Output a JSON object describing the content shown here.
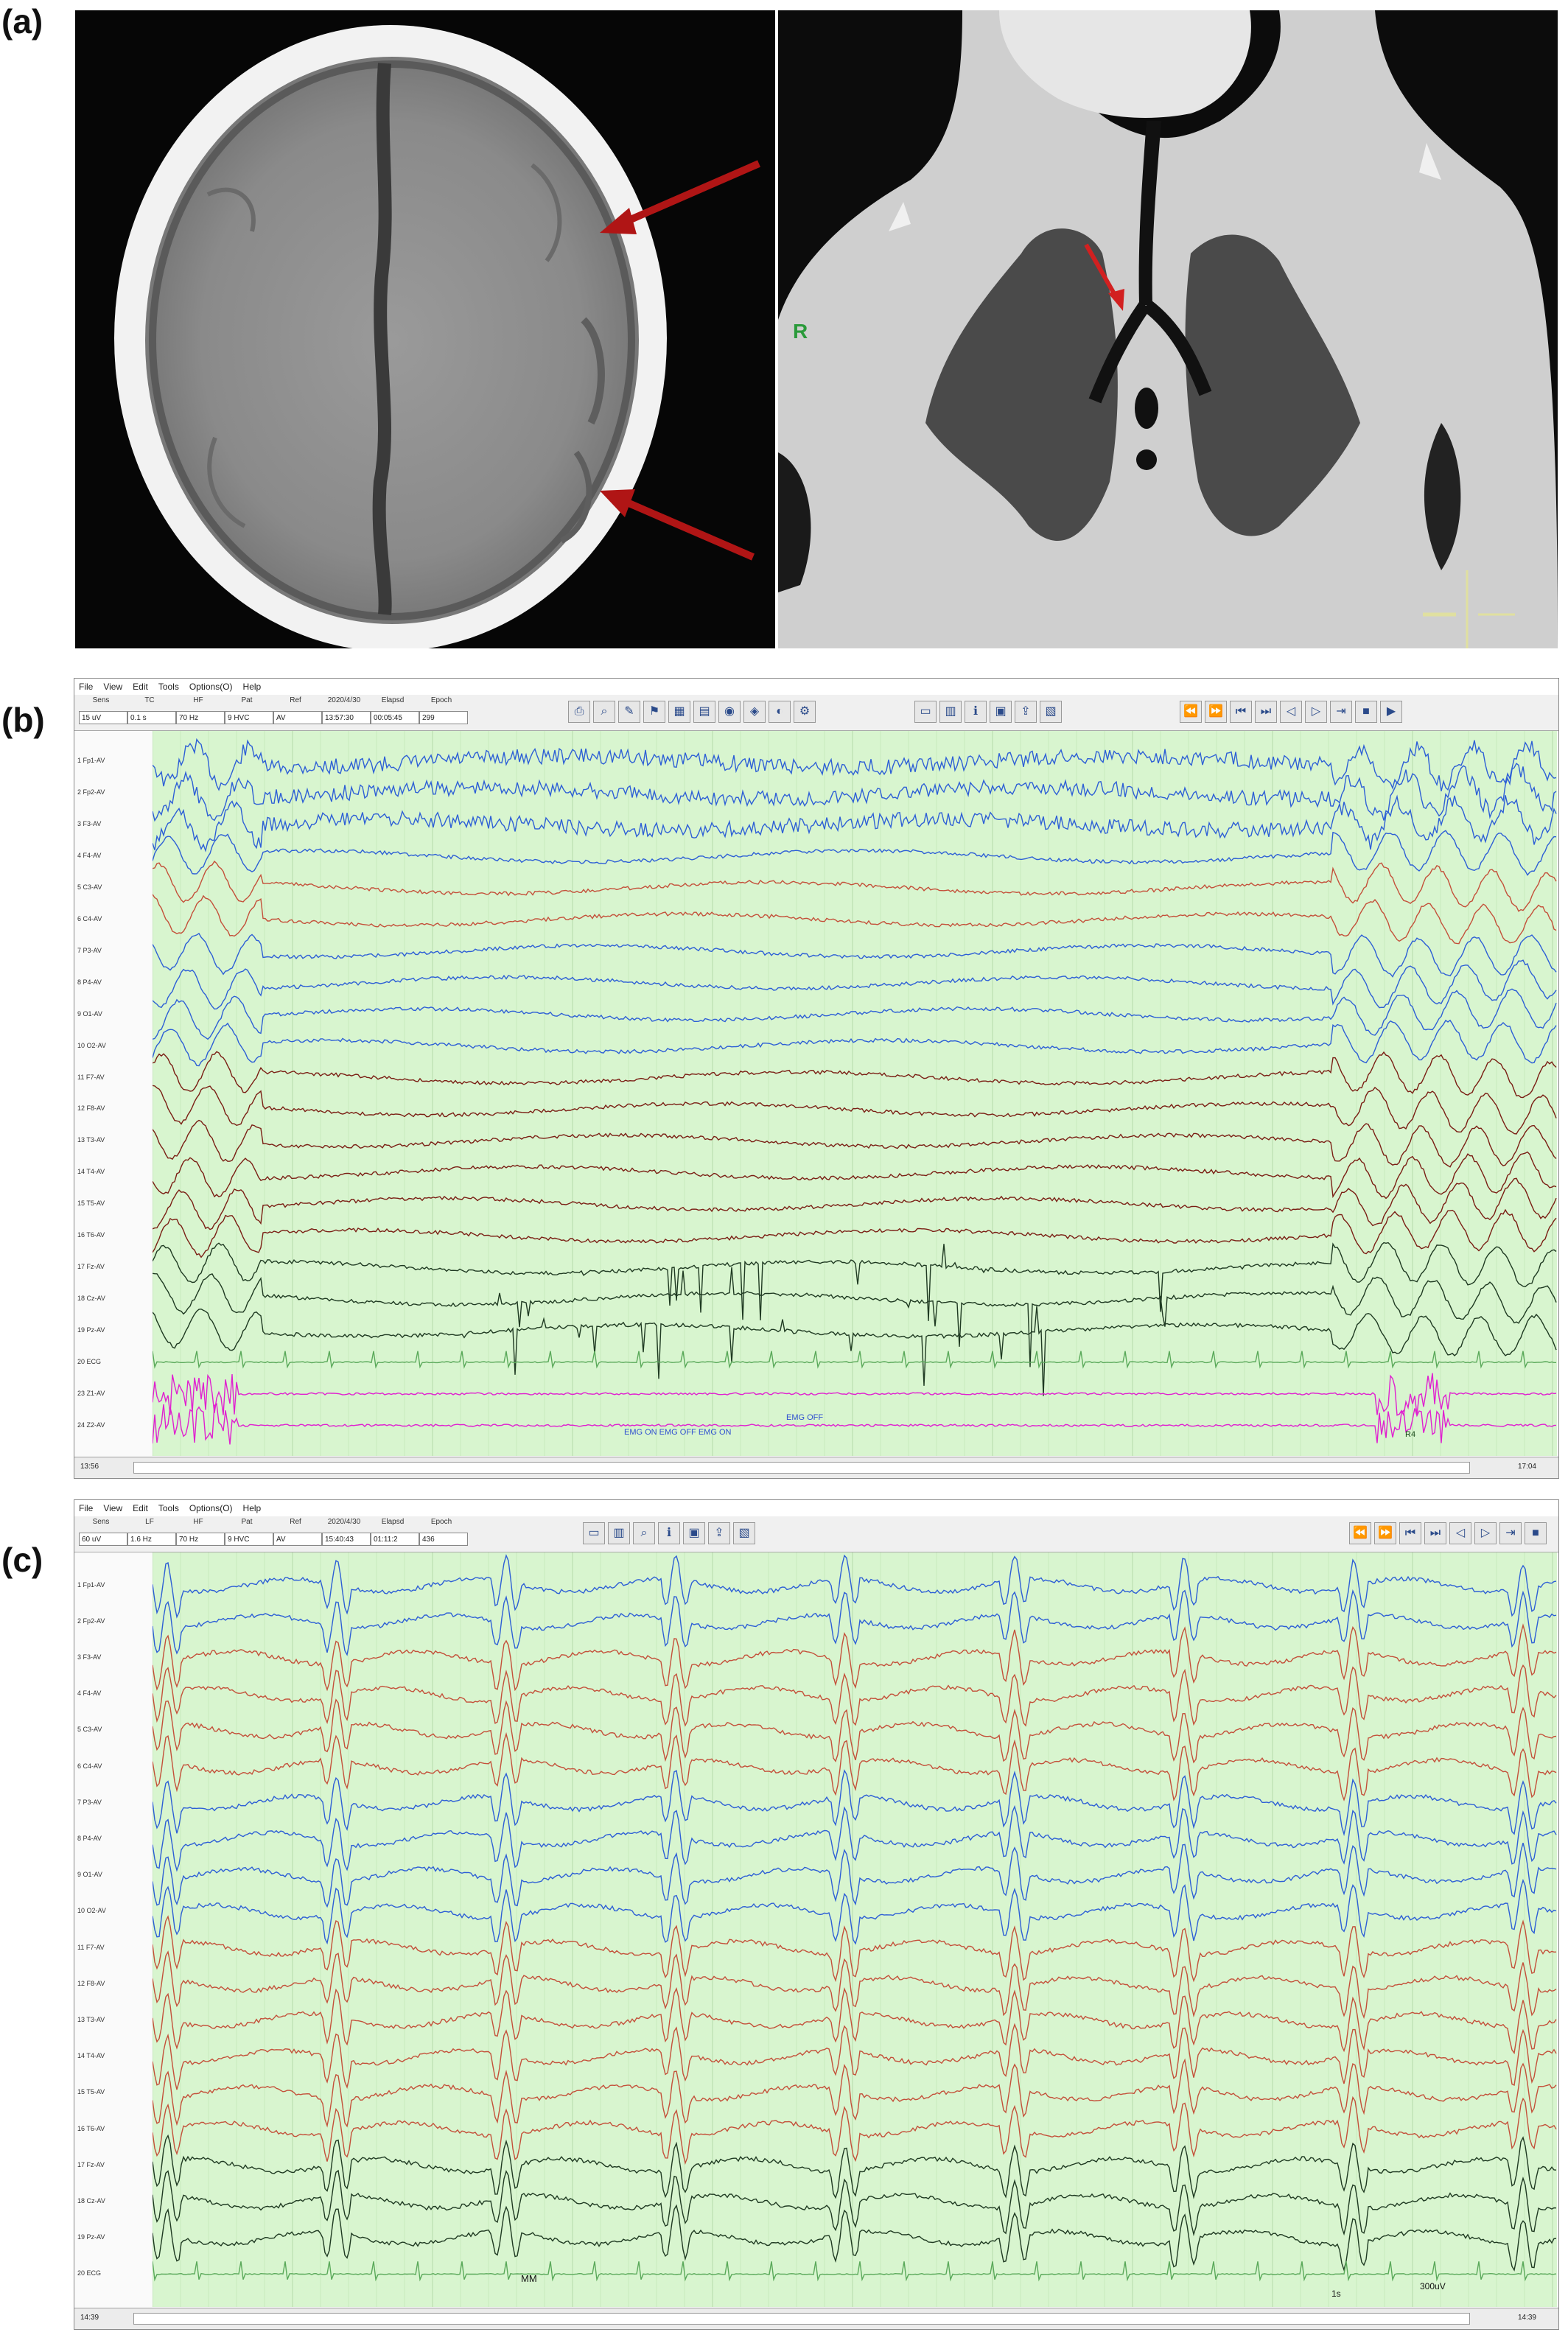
{
  "panels": {
    "a": "(a)",
    "b": "(b)",
    "c": "(c)"
  },
  "ct_chest": {
    "side_marker": "R"
  },
  "colors": {
    "arrow": "#b01515",
    "eeg_bg": "#d8f5cf",
    "frontal": "#2d5fd6",
    "temporal": "#c4503a",
    "central": "#7a1e14",
    "posterior": "#1f3a22",
    "ecg": "#5aa95a",
    "emg": "#e020d0"
  },
  "eeg_b": {
    "menu": [
      "File",
      "View",
      "Edit",
      "Tools",
      "Options(O)",
      "Help"
    ],
    "headers": [
      "Sens",
      "TC",
      "HF",
      "Pat",
      "Ref",
      "2020/4/30",
      "Elapsd",
      "Epoch"
    ],
    "values": [
      "15 uV",
      "0.1 s",
      "70 Hz",
      "9 HVC",
      "AV",
      "13:57:30",
      "00:05:45",
      "299"
    ],
    "channels": [
      "1 Fp1-AV",
      "2 Fp2-AV",
      "3 F3-AV",
      "4 F4-AV",
      "5 C3-AV",
      "6 C4-AV",
      "7 P3-AV",
      "8 P4-AV",
      "9 O1-AV",
      "10 O2-AV",
      "11 F7-AV",
      "12 F8-AV",
      "13 T3-AV",
      "14 T4-AV",
      "15 T5-AV",
      "16 T6-AV",
      "17 Fz-AV",
      "18 Cz-AV",
      "19 Pz-AV",
      "20 ECG",
      "23 Z1-AV",
      "24 Z2-AV"
    ],
    "annotations": {
      "right_box": "",
      "emg1": "EMG OFF",
      "emg2": "EMG ON  EMG OFF  EMG ON",
      "mark": "R4"
    },
    "status_left": "13:56",
    "status_right": "17:04"
  },
  "eeg_c": {
    "menu": [
      "File",
      "View",
      "Edit",
      "Tools",
      "Options(O)",
      "Help"
    ],
    "headers": [
      "Sens",
      "LF",
      "HF",
      "Pat",
      "Ref",
      "2020/4/30",
      "Elapsd",
      "Epoch"
    ],
    "values": [
      "60 uV",
      "1.6 Hz",
      "70 Hz",
      "9 HVC",
      "AV",
      "15:40:43",
      "01:11:2",
      "436"
    ],
    "channels": [
      "1 Fp1-AV",
      "2 Fp2-AV",
      "3 F3-AV",
      "4 F4-AV",
      "5 C3-AV",
      "6 C4-AV",
      "7 P3-AV",
      "8 P4-AV",
      "9 O1-AV",
      "10 O2-AV",
      "11 F7-AV",
      "12 F8-AV",
      "13 T3-AV",
      "14 T4-AV",
      "15 T5-AV",
      "16 T6-AV",
      "17 Fz-AV",
      "18 Cz-AV",
      "19 Pz-AV",
      "20 ECG"
    ],
    "annotations": {
      "right_box": "",
      "mark": "MM",
      "scale": "1s",
      "scale_uv": "300uV"
    },
    "status_left": "14:39",
    "status_right": "14:39"
  }
}
